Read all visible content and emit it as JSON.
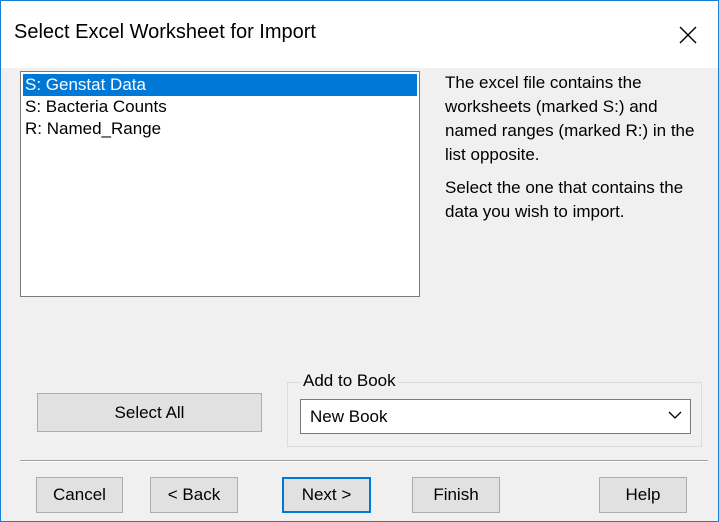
{
  "dialog": {
    "title": "Select Excel Worksheet for Import",
    "close_glyph": "close-icon"
  },
  "sheets": [
    "S: Genstat Data",
    "S: Bacteria Counts",
    "R: Named_Range"
  ],
  "selected_sheet_index": 0,
  "info": {
    "paragraph1": "The excel file contains the worksheets (marked S:) and named ranges (marked R:) in the list opposite.",
    "paragraph2": "Select the one that contains the data you wish to import."
  },
  "buttons": {
    "select_all": "Select All",
    "cancel": "Cancel",
    "back": "< Back",
    "next": "Next >",
    "finish": "Finish",
    "help": "Help"
  },
  "add_to_book": {
    "label": "Add to Book",
    "value": "New Book",
    "arrow_icon": "chevron-down-icon"
  },
  "colors": {
    "accent": "#0078d7",
    "dialog_bg": "#f0f0f0",
    "button_bg": "#e1e1e1"
  }
}
